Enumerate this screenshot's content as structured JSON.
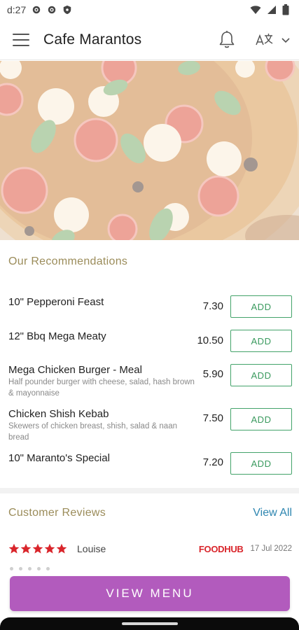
{
  "status_bar": {
    "time": "d:27"
  },
  "app_bar": {
    "title": "Cafe Marantos"
  },
  "recommendations": {
    "title": "Our Recommendations",
    "add_label": "ADD",
    "items": [
      {
        "name": "10\" Pepperoni Feast",
        "desc": "",
        "price": "7.30"
      },
      {
        "name": "12\" Bbq Mega Meaty",
        "desc": "",
        "price": "10.50"
      },
      {
        "name": "Mega Chicken Burger - Meal",
        "desc": "Half pounder burger with cheese, salad, hash brown & mayonnaise",
        "price": "5.90"
      },
      {
        "name": "Chicken Shish Kebab",
        "desc": "Skewers of chicken breast, shish, salad & naan bread",
        "price": "7.50"
      },
      {
        "name": "10\" Maranto's Special",
        "desc": "",
        "price": "7.20"
      }
    ]
  },
  "reviews": {
    "title": "Customer Reviews",
    "view_all": "View All",
    "items": [
      {
        "rating": 5,
        "name": "Louise",
        "source": "FOODHUB",
        "date": "17 Jul 2022"
      }
    ]
  },
  "cta": {
    "label": "VIEW MENU"
  },
  "colors": {
    "accent_gold": "#9b8c5a",
    "add_green": "#43a36a",
    "link_blue": "#2e86b0",
    "star_red": "#d9252b",
    "cta_purple": "#b25bbd"
  }
}
